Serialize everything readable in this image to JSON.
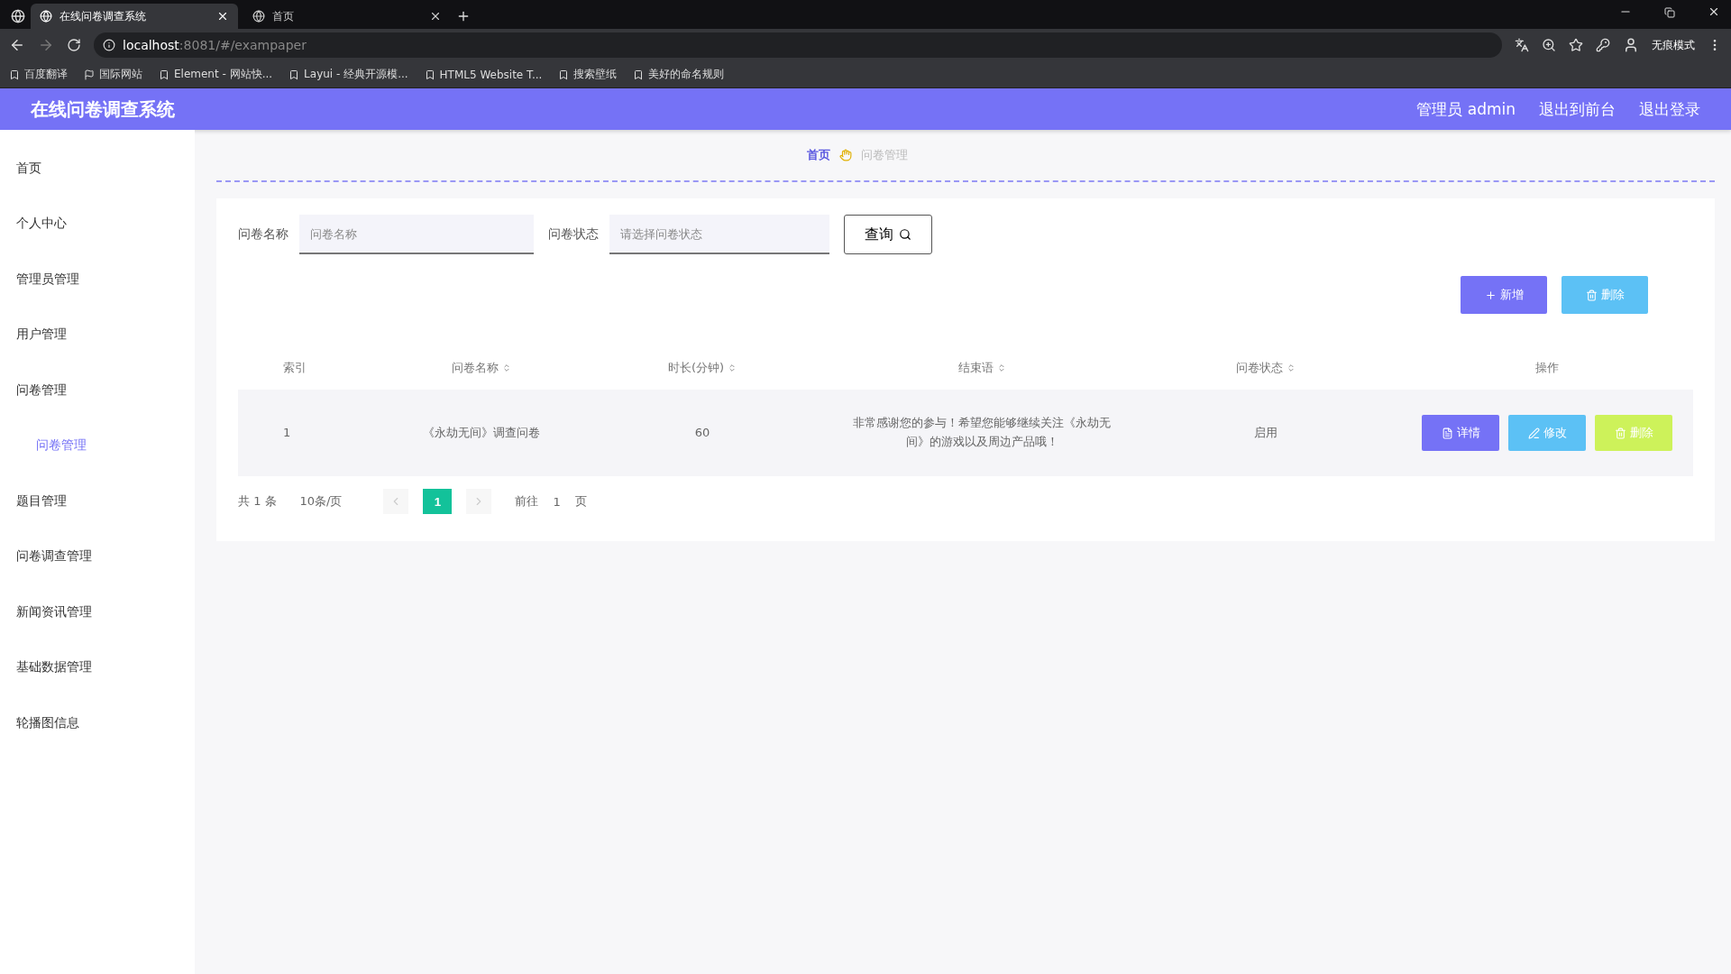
{
  "browser": {
    "tabs": [
      {
        "title": "在线问卷调查系统",
        "selected": true
      },
      {
        "title": "首页",
        "selected": false
      }
    ],
    "address": {
      "host": "localhost",
      "path": ":8081/#/exampaper"
    },
    "profile": "无痕模式",
    "bookmarks": [
      "百度翻译",
      "国际网站",
      "Element - 网站快...",
      "Layui - 经典开源模...",
      "HTML5 Website T...",
      "搜索壁纸",
      "美好的命名规则"
    ]
  },
  "header": {
    "title": "在线问卷调查系统",
    "links": [
      "管理员 admin",
      "退出到前台",
      "退出登录"
    ]
  },
  "sidebar": {
    "items": [
      {
        "label": "首页",
        "selected": false
      },
      {
        "label": "个人中心",
        "selected": false
      },
      {
        "label": "管理员管理",
        "selected": false
      },
      {
        "label": "用户管理",
        "selected": false
      },
      {
        "label": "问卷管理",
        "selected": false,
        "children": [
          {
            "label": "问卷管理",
            "selected": true
          }
        ]
      },
      {
        "label": "题目管理",
        "selected": false
      },
      {
        "label": "问卷调查管理",
        "selected": false
      },
      {
        "label": "新闻资讯管理",
        "selected": false
      },
      {
        "label": "基础数据管理",
        "selected": false
      },
      {
        "label": "轮播图信息",
        "selected": false
      }
    ]
  },
  "breadcrumb": [
    "首页",
    "问卷管理"
  ],
  "search": {
    "fields": [
      {
        "label": "问卷名称",
        "placeholder": "问卷名称"
      },
      {
        "label": "问卷状态",
        "placeholder": "请选择问卷状态"
      }
    ],
    "button": "查询"
  },
  "actions": [
    {
      "kind": "add",
      "label": "新增"
    },
    {
      "kind": "delete",
      "label": "删除"
    }
  ],
  "table": {
    "columns": [
      {
        "label": "索引",
        "sortable": false
      },
      {
        "label": "问卷名称",
        "sortable": true
      },
      {
        "label": "时长(分钟)",
        "sortable": true
      },
      {
        "label": "结束语",
        "sortable": true
      },
      {
        "label": "问卷状态",
        "sortable": true
      },
      {
        "label": "操作",
        "sortable": false
      }
    ],
    "rows": [
      {
        "cells": [
          "1",
          "《永劫无间》调查问卷",
          "60",
          "非常感谢您的参与！希望您能够继续关注《永劫无间》的游戏以及周边产品哦！",
          "启用"
        ],
        "buttons": [
          {
            "kind": "detail",
            "label": "详情"
          },
          {
            "kind": "edit",
            "label": "修改"
          },
          {
            "kind": "delete",
            "label": "删除"
          }
        ]
      }
    ]
  },
  "pagination": {
    "total": "共 1 条",
    "page_size": "10条/页",
    "pages": [
      {
        "label": "1",
        "selected": true
      }
    ],
    "goto_label": "前往",
    "goto_value": "1",
    "goto_suffix": "页"
  }
}
